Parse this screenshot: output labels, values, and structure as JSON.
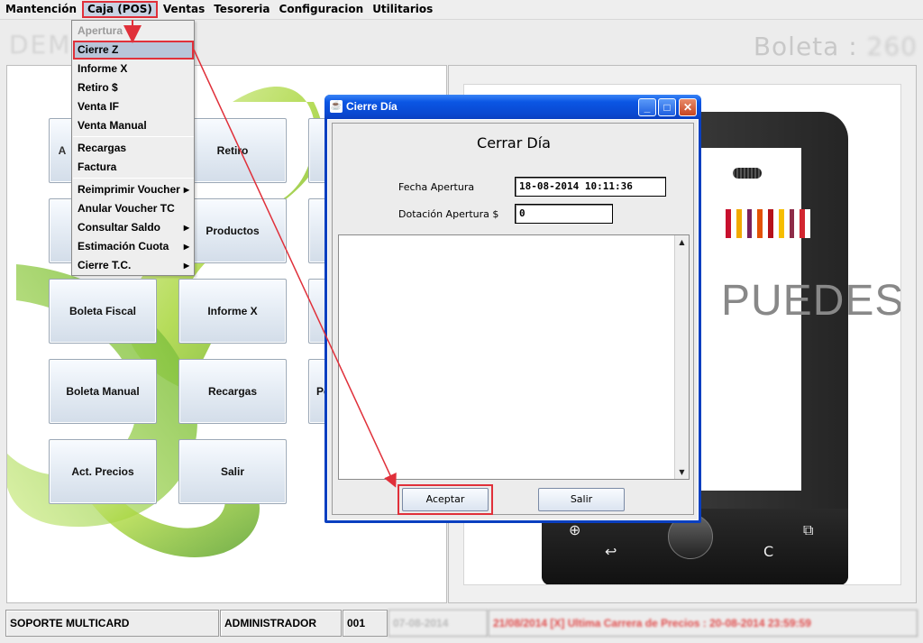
{
  "menubar": {
    "items": [
      "Mantención",
      "Caja (POS)",
      "Ventas",
      "Tesoreria",
      "Configuracion",
      "Utilitarios"
    ]
  },
  "header": {
    "left_text": "DEMO 1",
    "boleta_label": "Boleta : ",
    "boleta_number": "260"
  },
  "caja_menu": {
    "items": [
      {
        "label": "Apertura",
        "state": "disabled"
      },
      {
        "label": "Cierre Z",
        "state": "selected"
      },
      {
        "label": "Informe X"
      },
      {
        "label": "Retiro $"
      },
      {
        "label": "Venta IF"
      },
      {
        "label": "Venta Manual"
      },
      {
        "label": "Recargas"
      },
      {
        "label": "Factura"
      },
      {
        "label": "Reimprimir Voucher",
        "submenu": true
      },
      {
        "label": "Anular Voucher TC"
      },
      {
        "label": "Consultar Saldo",
        "submenu": true
      },
      {
        "label": "Estimación Cuota",
        "submenu": true
      },
      {
        "label": "Cierre T.C.",
        "submenu": true
      }
    ]
  },
  "tiles": {
    "retiro": "Retiro",
    "productos": "Productos",
    "boleta_fiscal": "Boleta Fiscal",
    "informe_x": "Informe X",
    "boleta_manual": "Boleta Manual",
    "recargas": "Recargas",
    "act_precios": "Act. Precios",
    "salir": "Salir",
    "partial_a": "A",
    "partial_pe": "Pe"
  },
  "ad": {
    "word": "PUEDES",
    "stripe_colors": [
      "#c8102e",
      "#f2a900",
      "#7a1f5c",
      "#e35205",
      "#b5121b",
      "#f6be00",
      "#8e2c48",
      "#d22630"
    ]
  },
  "dialog": {
    "title": "Cierre Día",
    "heading": "Cerrar Día",
    "fecha_label": "Fecha Apertura",
    "fecha_value": "18-08-2014 10:11:36",
    "dotacion_label": "Dotación Apertura $",
    "dotacion_value": "0",
    "accept_button": "Aceptar",
    "exit_button": "Salir",
    "java_icon": "java-cup-icon",
    "minimize_glyph": "_",
    "maximize_glyph": "□",
    "close_glyph": "✕"
  },
  "statusbar": {
    "company": "SOPORTE MULTICARD",
    "user": "ADMINISTRADOR",
    "terminal": "001",
    "date": "07-08-2014",
    "message": "21/08/2014 [X] Ultima Carrera de Precios : 20-08-2014 23:59:59"
  },
  "colors": {
    "highlight": "#e0303a",
    "title_bar": "#0a48d0",
    "swirl_green": "#9ccc3a"
  }
}
